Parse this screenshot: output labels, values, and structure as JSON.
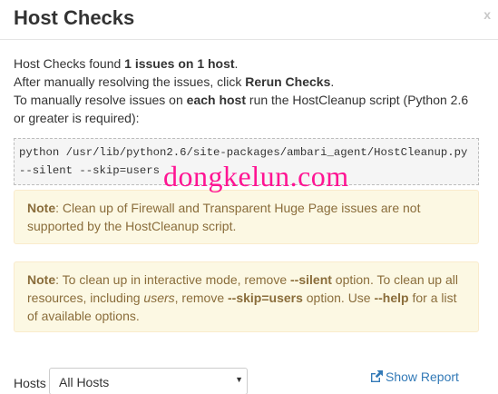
{
  "header": {
    "title": "Host Checks",
    "close_label": "x"
  },
  "intro": {
    "line1_prefix": "Host Checks found ",
    "line1_bold": "1 issues on 1 host",
    "line1_suffix": ".",
    "line2_prefix": "After manually resolving the issues, click ",
    "line2_bold": "Rerun Checks",
    "line2_suffix": ".",
    "line3_prefix": "To manually resolve issues on ",
    "line3_bold": "each host",
    "line3_suffix": " run the HostCleanup script (Python 2.6 or greater is required):"
  },
  "command": "python /usr/lib/python2.6/site-packages/ambari_agent/HostCleanup.py --silent --skip=users",
  "note1": {
    "label": "Note",
    "text": ": Clean up of Firewall and Transparent Huge Page issues are not supported by the HostCleanup script."
  },
  "note2": {
    "label": "Note",
    "t1": ": To clean up in interactive mode, remove ",
    "b1": "--silent",
    "t2": " option. To clean up all resources, including ",
    "i1": "users",
    "t3": ", remove ",
    "b2": "--skip=users",
    "t4": " option. Use ",
    "b3": "--help",
    "t5": " for a list of available options."
  },
  "footer": {
    "hosts_label": "Hosts",
    "hosts_selected": "All Hosts",
    "show_report": "Show Report"
  },
  "watermark": "dongkelun.com",
  "colors": {
    "link": "#337ab7",
    "alert_bg": "#fcf8e3",
    "alert_text": "#8a6d3b",
    "watermark": "#ff1493"
  }
}
